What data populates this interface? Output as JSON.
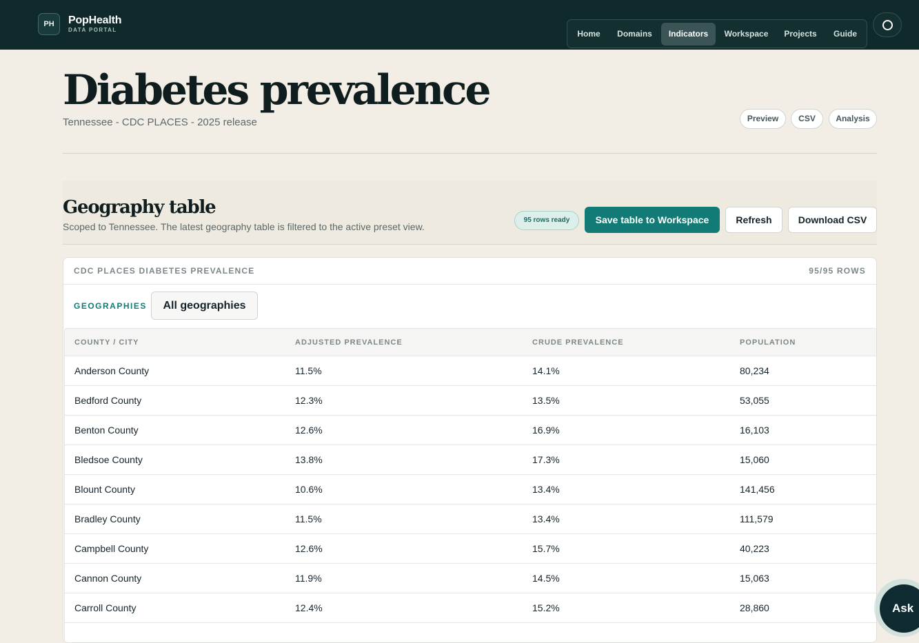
{
  "brand": {
    "badge": "PH",
    "name": "PopHealth",
    "subtitle": "DATA PORTAL"
  },
  "nav": {
    "items": [
      {
        "label": "Home"
      },
      {
        "label": "Domains"
      },
      {
        "label": "Indicators",
        "active": true
      },
      {
        "label": "Workspace"
      },
      {
        "label": "Projects"
      },
      {
        "label": "Guide"
      }
    ]
  },
  "user": {
    "icon": "user-circle-icon"
  },
  "header": {
    "title": "Diabetes prevalence",
    "subtitle": "Tennessee - CDC PLACES - 2025 release",
    "pills": [
      "Preview",
      "CSV",
      "Analysis"
    ]
  },
  "section": {
    "title": "Geography table",
    "description": "Scoped to Tennessee. The latest geography table is filtered to the active preset view.",
    "badge": "95 rows ready",
    "save_label": "Save table to Workspace",
    "refresh_label": "Refresh",
    "download_label": "Download CSV"
  },
  "table": {
    "title": "CDC PLACES DIABETES PREVALENCE",
    "count": "95/95 ROWS",
    "filter_label": "GEOGRAPHIES",
    "filter_value": "All geographies",
    "columns": [
      "COUNTY / CITY",
      "ADJUSTED PREVALENCE",
      "CRUDE PREVALENCE",
      "POPULATION"
    ],
    "rows": [
      [
        "Anderson County",
        "11.5%",
        "14.1%",
        "80,234"
      ],
      [
        "Bedford County",
        "12.3%",
        "13.5%",
        "53,055"
      ],
      [
        "Benton County",
        "12.6%",
        "16.9%",
        "16,103"
      ],
      [
        "Bledsoe County",
        "13.8%",
        "17.3%",
        "15,060"
      ],
      [
        "Blount County",
        "10.6%",
        "13.4%",
        "141,456"
      ],
      [
        "Bradley County",
        "11.5%",
        "13.4%",
        "111,579"
      ],
      [
        "Campbell County",
        "12.6%",
        "15.7%",
        "40,223"
      ],
      [
        "Cannon County",
        "11.9%",
        "14.5%",
        "15,063"
      ],
      [
        "Carroll County",
        "12.4%",
        "15.2%",
        "28,860"
      ]
    ]
  },
  "assistant": {
    "label": "Ask"
  },
  "colors": {
    "accent": "#137b75",
    "topbar": "#102a2b",
    "background": "#f2eee5"
  }
}
